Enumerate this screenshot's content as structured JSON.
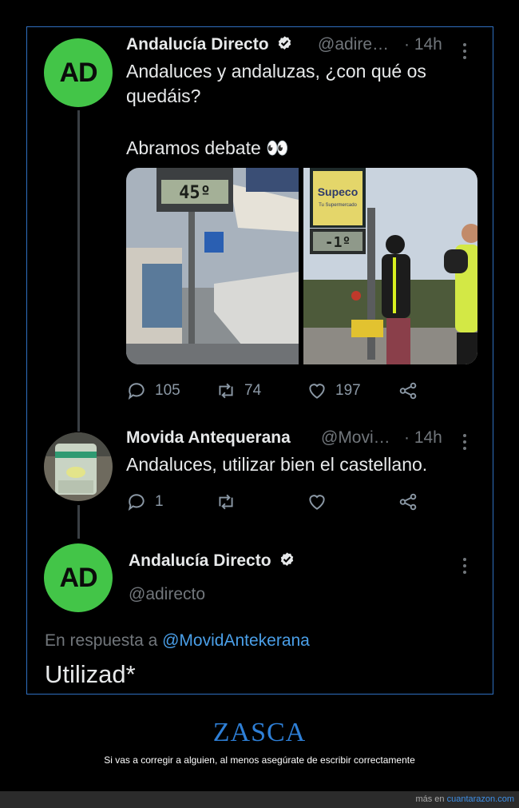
{
  "tweet1": {
    "author_name": "Andalucía Directo",
    "handle": "@adire…",
    "time": "· 14h",
    "avatar_text": "AD",
    "text_line1": "Andaluces y andaluzas, ¿con qué os",
    "text_line2": "quedáis?",
    "text_line3": "Abramos debate 👀",
    "left_image": {
      "display_text": "45º"
    },
    "right_image": {
      "sign_brand": "Supeco",
      "sign_subtext": "Tu Supermercado",
      "display_text": "-1º"
    },
    "replies": "105",
    "retweets": "74",
    "likes": "197"
  },
  "tweet2": {
    "author_name": "Movida Antequerana",
    "handle": "@Movi…",
    "time": "· 14h",
    "text": "Andaluces, utilizar bien el castellano.",
    "replies": "1"
  },
  "tweet3": {
    "author_name": "Andalucía Directo",
    "handle": "@adirecto",
    "avatar_text": "AD",
    "reply_prefix": "En respuesta a",
    "reply_mention": "@MovidAntekerana",
    "text": "Utilizad*"
  },
  "caption": {
    "title": "ZASCA",
    "subtitle": "Si vas a corregir a alguien, al menos asegúrate de escribir correctamente"
  },
  "footer": {
    "prefix": "más en",
    "link": "cuantarazon.com"
  },
  "colors": {
    "frame_border": "#2f6fbf",
    "avatar_green": "#43c548",
    "mention_blue": "#4a9fe8",
    "zasca_blue": "#2e7fd6"
  }
}
